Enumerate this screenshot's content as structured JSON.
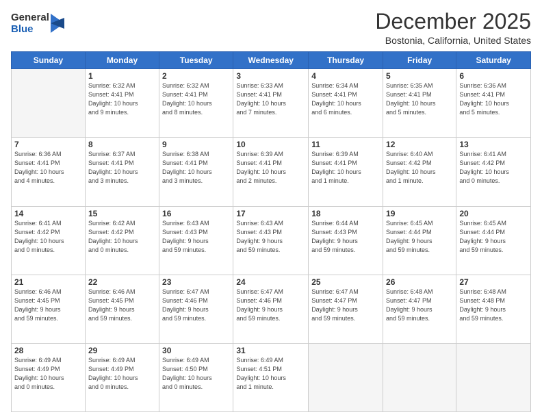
{
  "header": {
    "logo_general": "General",
    "logo_blue": "Blue",
    "month_title": "December 2025",
    "location": "Bostonia, California, United States"
  },
  "weekdays": [
    "Sunday",
    "Monday",
    "Tuesday",
    "Wednesday",
    "Thursday",
    "Friday",
    "Saturday"
  ],
  "weeks": [
    [
      {
        "day": "",
        "info": ""
      },
      {
        "day": "1",
        "info": "Sunrise: 6:32 AM\nSunset: 4:41 PM\nDaylight: 10 hours\nand 9 minutes."
      },
      {
        "day": "2",
        "info": "Sunrise: 6:32 AM\nSunset: 4:41 PM\nDaylight: 10 hours\nand 8 minutes."
      },
      {
        "day": "3",
        "info": "Sunrise: 6:33 AM\nSunset: 4:41 PM\nDaylight: 10 hours\nand 7 minutes."
      },
      {
        "day": "4",
        "info": "Sunrise: 6:34 AM\nSunset: 4:41 PM\nDaylight: 10 hours\nand 6 minutes."
      },
      {
        "day": "5",
        "info": "Sunrise: 6:35 AM\nSunset: 4:41 PM\nDaylight: 10 hours\nand 5 minutes."
      },
      {
        "day": "6",
        "info": "Sunrise: 6:36 AM\nSunset: 4:41 PM\nDaylight: 10 hours\nand 5 minutes."
      }
    ],
    [
      {
        "day": "7",
        "info": "Sunrise: 6:36 AM\nSunset: 4:41 PM\nDaylight: 10 hours\nand 4 minutes."
      },
      {
        "day": "8",
        "info": "Sunrise: 6:37 AM\nSunset: 4:41 PM\nDaylight: 10 hours\nand 3 minutes."
      },
      {
        "day": "9",
        "info": "Sunrise: 6:38 AM\nSunset: 4:41 PM\nDaylight: 10 hours\nand 3 minutes."
      },
      {
        "day": "10",
        "info": "Sunrise: 6:39 AM\nSunset: 4:41 PM\nDaylight: 10 hours\nand 2 minutes."
      },
      {
        "day": "11",
        "info": "Sunrise: 6:39 AM\nSunset: 4:41 PM\nDaylight: 10 hours\nand 1 minute."
      },
      {
        "day": "12",
        "info": "Sunrise: 6:40 AM\nSunset: 4:42 PM\nDaylight: 10 hours\nand 1 minute."
      },
      {
        "day": "13",
        "info": "Sunrise: 6:41 AM\nSunset: 4:42 PM\nDaylight: 10 hours\nand 0 minutes."
      }
    ],
    [
      {
        "day": "14",
        "info": "Sunrise: 6:41 AM\nSunset: 4:42 PM\nDaylight: 10 hours\nand 0 minutes."
      },
      {
        "day": "15",
        "info": "Sunrise: 6:42 AM\nSunset: 4:42 PM\nDaylight: 10 hours\nand 0 minutes."
      },
      {
        "day": "16",
        "info": "Sunrise: 6:43 AM\nSunset: 4:43 PM\nDaylight: 9 hours\nand 59 minutes."
      },
      {
        "day": "17",
        "info": "Sunrise: 6:43 AM\nSunset: 4:43 PM\nDaylight: 9 hours\nand 59 minutes."
      },
      {
        "day": "18",
        "info": "Sunrise: 6:44 AM\nSunset: 4:43 PM\nDaylight: 9 hours\nand 59 minutes."
      },
      {
        "day": "19",
        "info": "Sunrise: 6:45 AM\nSunset: 4:44 PM\nDaylight: 9 hours\nand 59 minutes."
      },
      {
        "day": "20",
        "info": "Sunrise: 6:45 AM\nSunset: 4:44 PM\nDaylight: 9 hours\nand 59 minutes."
      }
    ],
    [
      {
        "day": "21",
        "info": "Sunrise: 6:46 AM\nSunset: 4:45 PM\nDaylight: 9 hours\nand 59 minutes."
      },
      {
        "day": "22",
        "info": "Sunrise: 6:46 AM\nSunset: 4:45 PM\nDaylight: 9 hours\nand 59 minutes."
      },
      {
        "day": "23",
        "info": "Sunrise: 6:47 AM\nSunset: 4:46 PM\nDaylight: 9 hours\nand 59 minutes."
      },
      {
        "day": "24",
        "info": "Sunrise: 6:47 AM\nSunset: 4:46 PM\nDaylight: 9 hours\nand 59 minutes."
      },
      {
        "day": "25",
        "info": "Sunrise: 6:47 AM\nSunset: 4:47 PM\nDaylight: 9 hours\nand 59 minutes."
      },
      {
        "day": "26",
        "info": "Sunrise: 6:48 AM\nSunset: 4:47 PM\nDaylight: 9 hours\nand 59 minutes."
      },
      {
        "day": "27",
        "info": "Sunrise: 6:48 AM\nSunset: 4:48 PM\nDaylight: 9 hours\nand 59 minutes."
      }
    ],
    [
      {
        "day": "28",
        "info": "Sunrise: 6:49 AM\nSunset: 4:49 PM\nDaylight: 10 hours\nand 0 minutes."
      },
      {
        "day": "29",
        "info": "Sunrise: 6:49 AM\nSunset: 4:49 PM\nDaylight: 10 hours\nand 0 minutes."
      },
      {
        "day": "30",
        "info": "Sunrise: 6:49 AM\nSunset: 4:50 PM\nDaylight: 10 hours\nand 0 minutes."
      },
      {
        "day": "31",
        "info": "Sunrise: 6:49 AM\nSunset: 4:51 PM\nDaylight: 10 hours\nand 1 minute."
      },
      {
        "day": "",
        "info": ""
      },
      {
        "day": "",
        "info": ""
      },
      {
        "day": "",
        "info": ""
      }
    ]
  ]
}
